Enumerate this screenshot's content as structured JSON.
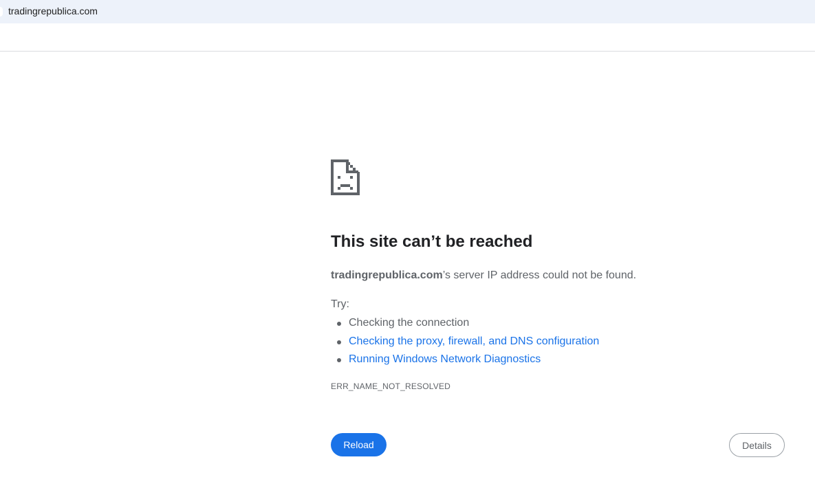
{
  "browser": {
    "url": "tradingrepublica.com"
  },
  "error_page": {
    "icon": "sad-page-icon",
    "title": "This site can’t be reached",
    "summary_host": "tradingrepublica.com",
    "summary_rest": "’s server IP address could not be found.",
    "try_label": "Try:",
    "suggestions": [
      {
        "text": "Checking the connection",
        "link": false
      },
      {
        "text": "Checking the proxy, firewall, and DNS configuration",
        "link": true
      },
      {
        "text": "Running Windows Network Diagnostics",
        "link": true
      }
    ],
    "error_code": "ERR_NAME_NOT_RESOLVED",
    "reload_label": "Reload",
    "details_label": "Details"
  },
  "colors": {
    "accent": "#1a73e8",
    "text_primary": "#202124",
    "text_secondary": "#5f6368",
    "address_bar_bg": "#edf2fa"
  }
}
